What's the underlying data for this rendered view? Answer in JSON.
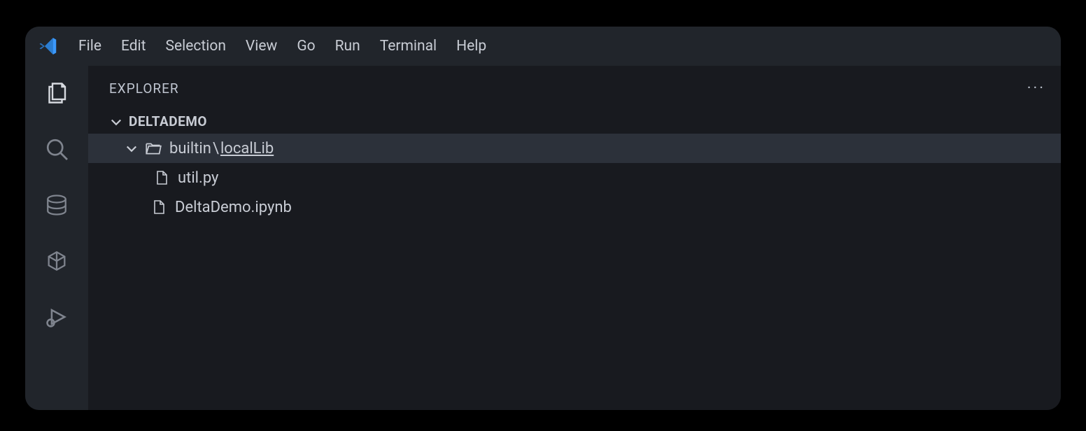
{
  "menu": {
    "items": [
      "File",
      "Edit",
      "Selection",
      "View",
      "Go",
      "Run",
      "Terminal",
      "Help"
    ]
  },
  "sidebar": {
    "title": "EXPLORER",
    "workspace": "DELTADEMO"
  },
  "tree": {
    "folder": {
      "prefix": "builtin",
      "separator": "\\",
      "name": "localLib"
    },
    "files": [
      {
        "name": "util.py"
      },
      {
        "name": "DeltaDemo.ipynb"
      }
    ]
  }
}
